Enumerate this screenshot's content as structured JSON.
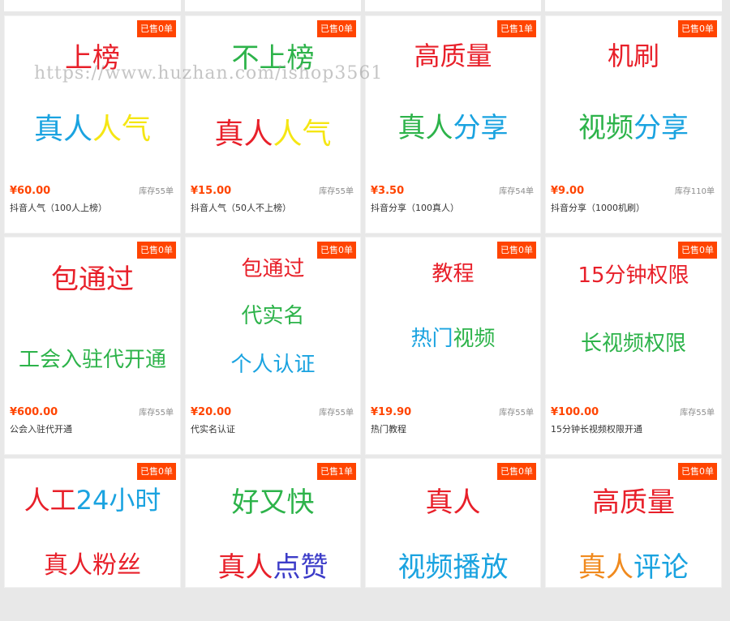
{
  "watermark": "https://www.huzhan.com/ishop3561",
  "rows": [
    {
      "cards": [
        {
          "badge": "已售0单",
          "art": [
            {
              "parts": [
                {
                  "text": "上榜",
                  "color": "#e8202a"
                }
              ],
              "size": 34
            },
            {
              "parts": [
                {
                  "text": "真人",
                  "color": "#1aa3e0"
                },
                {
                  "text": "人气",
                  "color": "#f5e614"
                }
              ],
              "size": 36
            }
          ],
          "price": "¥60.00",
          "stock": "库存55单",
          "title": "抖音人气（100人上榜）"
        },
        {
          "badge": "已售0单",
          "art": [
            {
              "parts": [
                {
                  "text": "不上榜",
                  "color": "#2db34a"
                }
              ],
              "size": 34
            },
            {
              "parts": [
                {
                  "text": "真人",
                  "color": "#e8202a"
                },
                {
                  "text": "人气",
                  "color": "#f5e614"
                }
              ],
              "size": 36
            }
          ],
          "price": "¥15.00",
          "stock": "库存55单",
          "title": "抖音人气（50人不上榜）"
        },
        {
          "badge": "已售1单",
          "art": [
            {
              "parts": [
                {
                  "text": "高质量",
                  "color": "#e8202a"
                }
              ],
              "size": 32
            },
            {
              "parts": [
                {
                  "text": "真人",
                  "color": "#2db34a"
                },
                {
                  "text": "分享",
                  "color": "#1aa3e0"
                }
              ],
              "size": 34
            }
          ],
          "price": "¥3.50",
          "stock": "库存54单",
          "title": "抖音分享（100真人）"
        },
        {
          "badge": "已售0单",
          "art": [
            {
              "parts": [
                {
                  "text": "机刷",
                  "color": "#e8202a"
                }
              ],
              "size": 32
            },
            {
              "parts": [
                {
                  "text": "视频",
                  "color": "#2db34a"
                },
                {
                  "text": "分享",
                  "color": "#1aa3e0"
                }
              ],
              "size": 34
            }
          ],
          "price": "¥9.00",
          "stock": "库存110单",
          "title": "抖音分享（1000机刷）"
        }
      ]
    },
    {
      "cards": [
        {
          "badge": "已售0单",
          "art": [
            {
              "parts": [
                {
                  "text": "包通过",
                  "color": "#e8202a"
                }
              ],
              "size": 34
            },
            {
              "parts": [
                {
                  "text": "工会入驻代开通",
                  "color": "#2db34a"
                }
              ],
              "size": 26
            }
          ],
          "price": "¥600.00",
          "stock": "库存55单",
          "title": "公会入驻代开通"
        },
        {
          "badge": "已售0单",
          "art": [
            {
              "parts": [
                {
                  "text": "包通过",
                  "color": "#e8202a"
                }
              ],
              "size": 26
            },
            {
              "parts": [
                {
                  "text": "代实名",
                  "color": "#2db34a"
                }
              ],
              "size": 26
            },
            {
              "parts": [
                {
                  "text": "个人认证",
                  "color": "#1aa3e0"
                }
              ],
              "size": 26
            }
          ],
          "price": "¥20.00",
          "stock": "库存55单",
          "title": "代实名认证"
        },
        {
          "badge": "已售0单",
          "art": [
            {
              "parts": [
                {
                  "text": "教程",
                  "color": "#e8202a"
                }
              ],
              "size": 26
            },
            {
              "parts": [
                {
                  "text": "热门",
                  "color": "#1aa3e0"
                },
                {
                  "text": "视频",
                  "color": "#2db34a"
                }
              ],
              "size": 26
            }
          ],
          "price": "¥19.90",
          "stock": "库存55单",
          "title": "热门教程"
        },
        {
          "badge": "已售0单",
          "art": [
            {
              "parts": [
                {
                  "text": "15分钟权限",
                  "color": "#e8202a"
                }
              ],
              "size": 26
            },
            {
              "parts": [
                {
                  "text": "长视频权限",
                  "color": "#2db34a"
                }
              ],
              "size": 26
            }
          ],
          "price": "¥100.00",
          "stock": "库存55单",
          "title": "15分钟长视频权限开通"
        }
      ]
    },
    {
      "cards": [
        {
          "badge": "已售0单",
          "art": [
            {
              "parts": [
                {
                  "text": "人工",
                  "color": "#e8202a"
                },
                {
                  "text": "24小时",
                  "color": "#1aa3e0"
                }
              ],
              "size": 32
            },
            {
              "parts": [
                {
                  "text": "真人粉丝",
                  "color": "#e8202a"
                }
              ],
              "size": 30
            }
          ]
        },
        {
          "badge": "已售1单",
          "art": [
            {
              "parts": [
                {
                  "text": "好又快",
                  "color": "#2db34a"
                }
              ],
              "size": 34
            },
            {
              "parts": [
                {
                  "text": "真人",
                  "color": "#e8202a"
                },
                {
                  "text": "点赞",
                  "color": "#3c3cc8"
                }
              ],
              "size": 34
            }
          ]
        },
        {
          "badge": "已售0单",
          "art": [
            {
              "parts": [
                {
                  "text": "真人",
                  "color": "#e8202a"
                }
              ],
              "size": 34
            },
            {
              "parts": [
                {
                  "text": "视频播放",
                  "color": "#1aa3e0"
                }
              ],
              "size": 34
            }
          ]
        },
        {
          "badge": "已售0单",
          "art": [
            {
              "parts": [
                {
                  "text": "高质量",
                  "color": "#e8202a"
                }
              ],
              "size": 34
            },
            {
              "parts": [
                {
                  "text": "真人",
                  "color": "#f08a1e"
                },
                {
                  "text": "评论",
                  "color": "#1aa3e0"
                }
              ],
              "size": 34
            }
          ]
        }
      ]
    }
  ]
}
